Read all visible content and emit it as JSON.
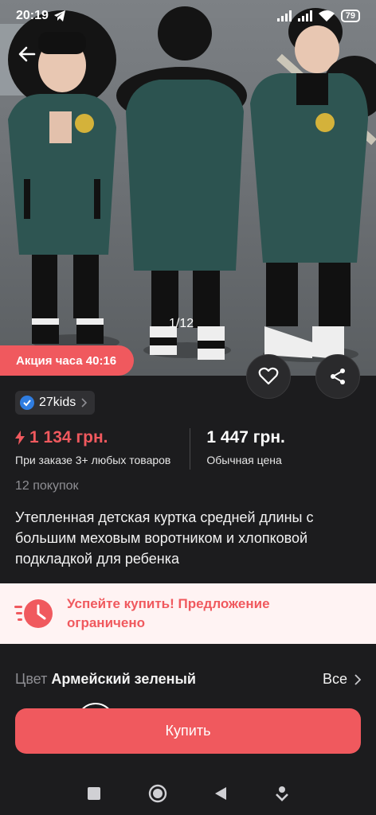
{
  "status": {
    "time": "20:19",
    "battery": "79"
  },
  "gallery": {
    "counter": "1/12"
  },
  "promo": {
    "label": "Акция часа 40:16"
  },
  "seller": {
    "name": "27kids"
  },
  "price": {
    "current": "1 134 грн.",
    "current_note": "При заказе 3+ любых товаров",
    "regular": "1 447 грн.",
    "regular_note": "Обычная цена",
    "accent_color": "#f0595e"
  },
  "purchases": "12 покупок",
  "product_title": "Утепленная детская куртка средней длины с большим меховым воротником и хлопковой подкладкой для ребенка",
  "urgency": {
    "text": "Успейте купить! Предложение ограничено"
  },
  "variant": {
    "label": "Цвет",
    "value": "Армейский зеленый",
    "all": "Все"
  },
  "actions": {
    "buy": "Купить"
  },
  "icons": [
    "telegram-icon",
    "signal-icon",
    "wifi-icon",
    "battery-icon",
    "back-arrow-icon",
    "heart-icon",
    "share-icon",
    "verified-icon",
    "lightning-icon",
    "clock-icon",
    "chevron-right-icon",
    "nav-square-icon",
    "nav-home-icon",
    "nav-back-icon",
    "nav-download-icon"
  ]
}
